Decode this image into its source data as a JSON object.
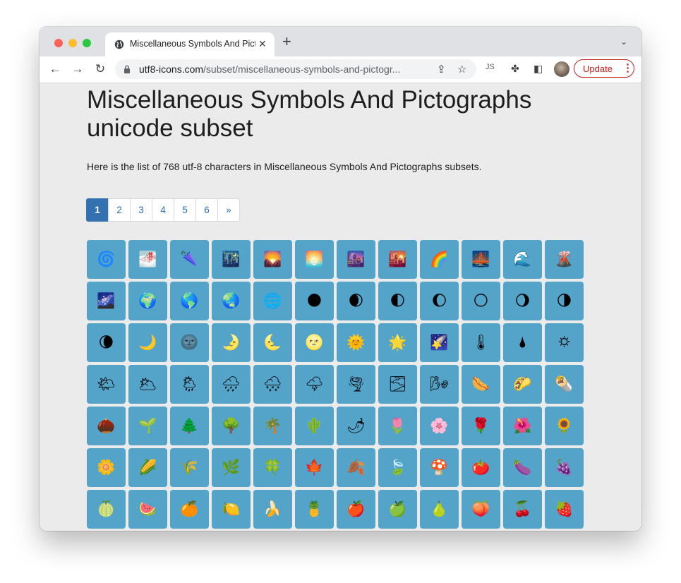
{
  "browser": {
    "tab_title": "Miscellaneous Symbols And Pictographs",
    "tab_close": "✕",
    "new_tab": "+",
    "tab_menu": "⌄",
    "url_host": "utf8-icons.com",
    "url_path": "/subset/miscellaneous-symbols-and-pictogr...",
    "update_label": "Update",
    "update_menu": "⋮",
    "icons": {
      "back": "back-arrow-icon",
      "forward": "forward-arrow-icon",
      "reload": "reload-icon",
      "lock": "lock-icon",
      "share": "share-icon",
      "bookmark": "star-icon",
      "extension": "puzzle-icon",
      "sidepanel": "side-panel-icon"
    }
  },
  "page": {
    "title": "Miscellaneous Symbols And Pictographs unicode subset",
    "description": "Here is the list of 768 utf-8 characters in Miscellaneous Symbols And Pictographs subsets.",
    "pagination": [
      {
        "label": "1",
        "active": true
      },
      {
        "label": "2"
      },
      {
        "label": "3"
      },
      {
        "label": "4"
      },
      {
        "label": "5"
      },
      {
        "label": "6"
      },
      {
        "label": "»"
      }
    ],
    "symbols": [
      "🌀",
      "🌁",
      "🌂",
      "🌃",
      "🌄",
      "🌅",
      "🌆",
      "🌇",
      "🌈",
      "🌉",
      "🌊",
      "🌋",
      "🌌",
      "🌍",
      "🌎",
      "🌏",
      "🌐",
      "🌑",
      "🌒",
      "🌓",
      "🌔",
      "🌕",
      "🌖",
      "🌗",
      "🌘",
      "🌙",
      "🌚",
      "🌛",
      "🌜",
      "🌝",
      "🌞",
      "🌟",
      "🌠",
      "🌡",
      "🌢",
      "🌣",
      "🌤",
      "🌥",
      "🌦",
      "🌧",
      "🌨",
      "🌩",
      "🌪",
      "🌫",
      "🌬",
      "🌭",
      "🌮",
      "🌯",
      "🌰",
      "🌱",
      "🌲",
      "🌳",
      "🌴",
      "🌵",
      "🌶",
      "🌷",
      "🌸",
      "🌹",
      "🌺",
      "🌻",
      "🌼",
      "🌽",
      "🌾",
      "🌿",
      "🍀",
      "🍁",
      "🍂",
      "🍃",
      "🍄",
      "🍅",
      "🍆",
      "🍇",
      "🍈",
      "🍉",
      "🍊",
      "🍋",
      "🍌",
      "🍍",
      "🍎",
      "🍏",
      "🍐",
      "🍑",
      "🍒",
      "🍓"
    ]
  },
  "colors": {
    "tile": "#54a3c9",
    "pager_active": "#3471b0",
    "update": "#c5221f"
  }
}
